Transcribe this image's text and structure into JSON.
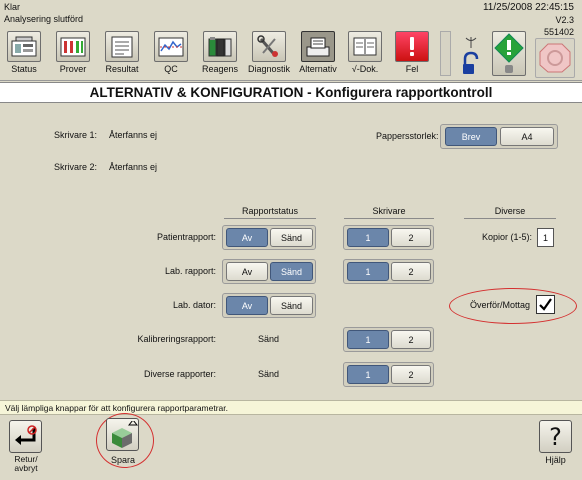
{
  "status": {
    "line1": "Klar",
    "line2": "Analysering slutförd"
  },
  "clock": {
    "date_time": "11/25/2008  22:45:15",
    "version": "V2.3",
    "serial": "551402"
  },
  "toolbar": [
    {
      "label": "Status",
      "icon": "status-icon"
    },
    {
      "label": "Prover",
      "icon": "samples-icon"
    },
    {
      "label": "Resultat",
      "icon": "results-icon"
    },
    {
      "label": "QC",
      "icon": "qc-icon"
    },
    {
      "label": "Reagens",
      "icon": "reagent-icon"
    },
    {
      "label": "Diagnostik",
      "icon": "diagnostics-icon"
    },
    {
      "label": "Alternativ",
      "icon": "options-icon",
      "active": true
    },
    {
      "label": "√-Dok.",
      "icon": "document-icon"
    },
    {
      "label": "Fel",
      "icon": "error-icon"
    }
  ],
  "title": "ALTERNATIV & KONFIGURATION - Konfigurera rapportkontroll",
  "printers": {
    "p1_label": "Skrivare 1:",
    "p1_value": "Återfanns ej",
    "p2_label": "Skrivare 2:",
    "p2_value": "Återfanns ej"
  },
  "paper": {
    "label": "Pappersstorlek:",
    "options": [
      "Brev",
      "A4"
    ],
    "selected": "Brev"
  },
  "headers": {
    "report_status": "Rapportstatus",
    "printer": "Skrivare",
    "misc": "Diverse"
  },
  "rows": [
    {
      "label": "Patientrapport:",
      "status": [
        "Av",
        "Sänd"
      ],
      "status_selected": "Av",
      "printer": [
        "1",
        "2"
      ],
      "printer_selected": "1"
    },
    {
      "label": "Lab. rapport:",
      "status": [
        "Av",
        "Sänd"
      ],
      "status_selected": "Sänd",
      "printer": [
        "1",
        "2"
      ],
      "printer_selected": "1"
    },
    {
      "label": "Lab. dator:",
      "status": [
        "Av",
        "Sänd"
      ],
      "status_selected": "Av"
    },
    {
      "label": "Kalibreringsrapport:",
      "status_text": "Sänd",
      "printer": [
        "1",
        "2"
      ],
      "printer_selected": "1"
    },
    {
      "label": "Diverse rapporter:",
      "status_text": "Sänd",
      "printer": [
        "1",
        "2"
      ],
      "printer_selected": "1"
    }
  ],
  "misc": {
    "copies_label": "Kopior (1-5):",
    "copies_value": "1",
    "transfer_label": "Överför/Mottag",
    "transfer_checked": true
  },
  "message": "Välj lämpliga knappar för att konfigurera rapportparametrar.",
  "footer": {
    "back": "Retur/\navbryt",
    "save": "Spara",
    "help": "Hjälp"
  },
  "colors": {
    "selected": "#6b86aa",
    "background": "#dcd9c8",
    "highlight_ring": "#d43030"
  }
}
